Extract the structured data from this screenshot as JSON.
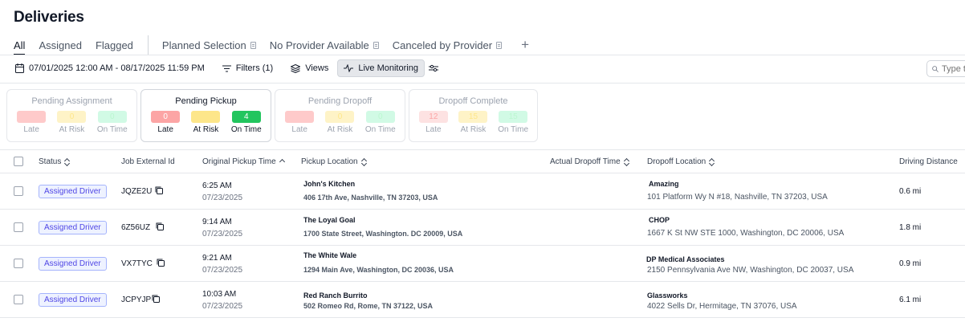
{
  "page_title": "Deliveries",
  "tabs": [
    {
      "label": "All",
      "active": true
    },
    {
      "label": "Assigned"
    },
    {
      "label": "Flagged"
    },
    {
      "label": "Planned Selection",
      "icon": "saved-view-icon"
    },
    {
      "label": "No Provider Available",
      "icon": "saved-view-icon"
    },
    {
      "label": "Canceled by Provider",
      "icon": "saved-view-icon"
    }
  ],
  "add_tab_label": "+",
  "toolbar": {
    "date_range": "07/01/2025 12:00 AM - 08/17/2025 11:59 PM",
    "filters_label": "Filters (1)",
    "views_label": "Views",
    "live_label": "Live Monitoring",
    "search_placeholder": "Type to search"
  },
  "cards": [
    {
      "title": "Pending Assignment",
      "late": "0",
      "at_risk": "0",
      "on_time": "0",
      "selected": false
    },
    {
      "title": "Pending Pickup",
      "late": "0",
      "at_risk": "0",
      "on_time": "4",
      "selected": true
    },
    {
      "title": "Pending Dropoff",
      "late": "0",
      "at_risk": "0",
      "on_time": "0",
      "selected": false
    },
    {
      "title": "Dropoff Complete",
      "late": "12",
      "at_risk": "15",
      "on_time": "15",
      "selected": false
    }
  ],
  "metric_labels": {
    "late": "Late",
    "at_risk": "At Risk",
    "on_time": "On Time"
  },
  "colors": {
    "late": "#fca5a5",
    "at_risk": "#fde68a",
    "on_time": "#22c55e",
    "badge": "#4f46e5"
  },
  "columns": {
    "status": "Status",
    "job_id": "Job External Id",
    "pickup_time": "Original Pickup Time",
    "pickup_location": "Pickup Location",
    "actual_dropoff": "Actual Dropoff Time",
    "dropoff_location": "Dropoff Location",
    "distance": "Driving Distance"
  },
  "rows": [
    {
      "status": "Assigned Driver",
      "job_id": "JQZE2U",
      "time": "6:25 AM",
      "date": "07/23/2025",
      "pickup_name": "John's Kitchen",
      "pickup_addr": "406 17th Ave, Nashville, TN 37203, USA",
      "dropoff_name": "Amazing",
      "dropoff_addr": "101 Platform Wy N #18, Nashville, TN 37203, USA",
      "distance": "0.6 mi"
    },
    {
      "status": "Assigned Driver",
      "job_id": "6Z56UZ",
      "time": "9:14 AM",
      "date": "07/23/2025",
      "pickup_name": "The Loyal Goal",
      "pickup_addr": "1700 State Street, Washington. DC 20009, USA",
      "dropoff_name": "CHOP",
      "dropoff_addr": "1667 K St NW STE 1000, Washington, DC 20006, USA",
      "distance": "1.8 mi"
    },
    {
      "status": "Assigned Driver",
      "job_id": "VX7TYC",
      "time": "9:21 AM",
      "date": "07/23/2025",
      "pickup_name": "The White Wale",
      "pickup_addr": "1294 Main Ave, Washington, DC  20036, USA",
      "dropoff_name": "DP Medical Associates",
      "dropoff_addr": "2150 Pennsylvania Ave NW, Washington, DC 20037, USA",
      "distance": "0.9 mi"
    },
    {
      "status": "Assigned Driver",
      "job_id": "JCPYJP",
      "time": "10:03 AM",
      "date": "07/23/2025",
      "pickup_name": "Red Ranch Burrito",
      "pickup_addr": "502 Romeo Rd, Rome, TN 37122, USA",
      "dropoff_name": "Glassworks",
      "dropoff_addr": "4022 Sells Dr, Hermitage, TN 37076, USA",
      "distance": "6.1 mi"
    }
  ]
}
